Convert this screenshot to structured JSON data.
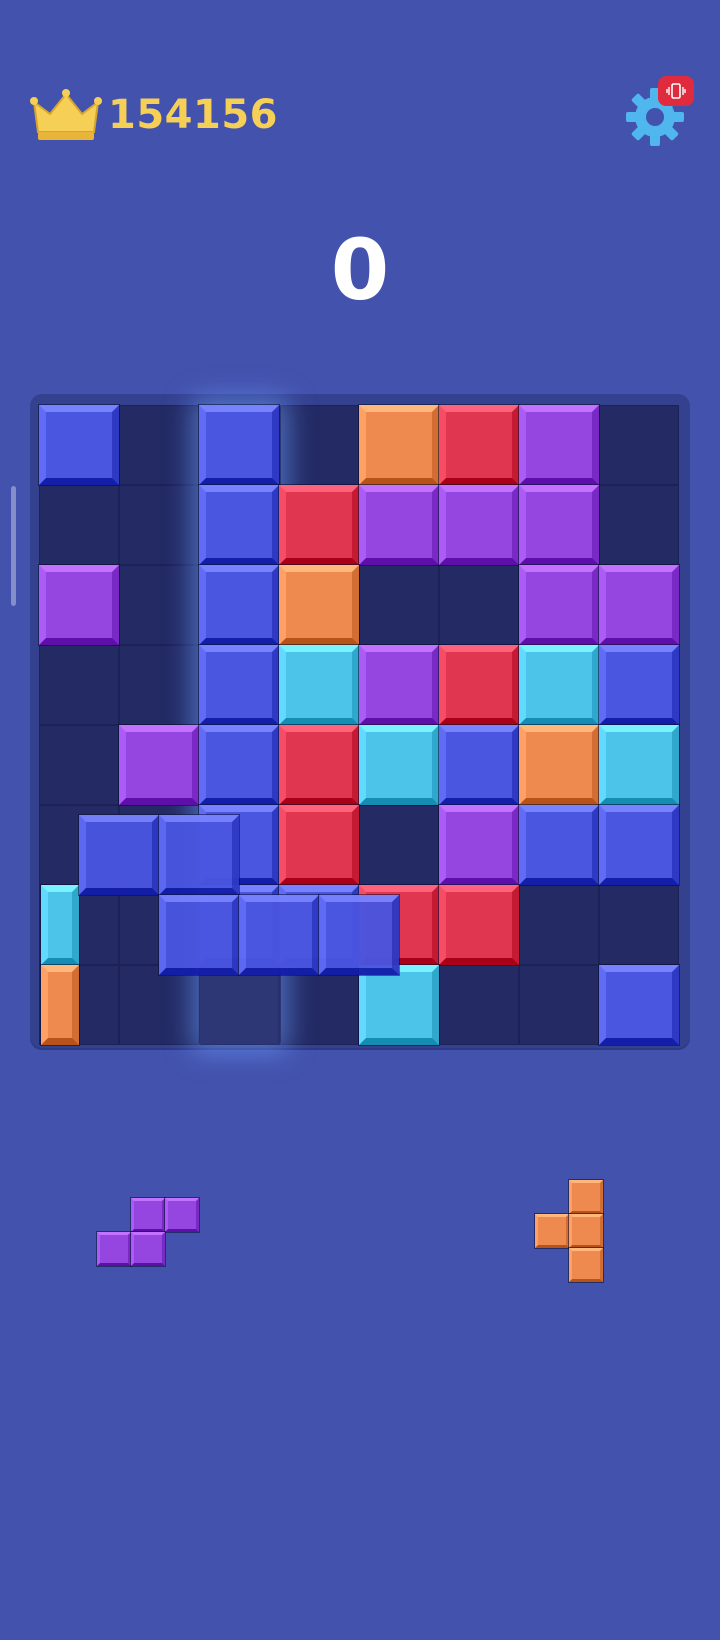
{
  "hud": {
    "best_score": "154156",
    "current_score": "0",
    "crown_icon": "crown-icon",
    "settings_icon": "gear-icon",
    "vibration_icon": "vibration-icon"
  },
  "colors": {
    "background": "#4352ad",
    "board_empty": "#232a64",
    "gold": "#f6cf57",
    "blue": "#4a55e0",
    "purple": "#9545e0",
    "red": "#e0364f",
    "orange": "#ee8a4f",
    "cyan": "#4cc4ea",
    "badge_red": "#e02a3d"
  },
  "board": {
    "rows": 8,
    "cols": 8,
    "highlighted_column": 2,
    "grid": [
      [
        "blue",
        null,
        "blue",
        null,
        "orange",
        "red",
        "purple",
        null
      ],
      [
        null,
        null,
        "blue",
        "red",
        "purple",
        "purple",
        "purple",
        null
      ],
      [
        "purple",
        null,
        "blue",
        "orange",
        null,
        null,
        "purple",
        "purple"
      ],
      [
        null,
        null,
        "blue",
        "cyan",
        "purple",
        "red",
        "cyan",
        "blue"
      ],
      [
        null,
        "purple",
        "blue",
        "red",
        "cyan",
        "blue",
        "orange",
        "cyan"
      ],
      [
        null,
        null,
        "blue",
        "red",
        null,
        "purple",
        "blue",
        "blue"
      ],
      [
        null,
        null,
        "blue",
        "blue",
        "red",
        "red",
        null,
        null
      ],
      [
        null,
        null,
        null,
        null,
        "cyan",
        null,
        null,
        "blue"
      ]
    ]
  },
  "dragging_piece": {
    "color": "blue",
    "cells": [
      [
        0,
        0
      ],
      [
        0,
        1
      ],
      [
        1,
        1
      ],
      [
        1,
        2
      ],
      [
        1,
        3
      ]
    ]
  },
  "edge_blocks": [
    {
      "color": "cyan",
      "row": 6
    },
    {
      "color": "orange",
      "row": 7
    }
  ],
  "tray": [
    {
      "color": "purple",
      "cells": [
        [
          0,
          1
        ],
        [
          0,
          2
        ],
        [
          1,
          0
        ],
        [
          1,
          1
        ]
      ]
    },
    {
      "color": "orange",
      "cells": [
        [
          0,
          1
        ],
        [
          1,
          0
        ],
        [
          1,
          1
        ],
        [
          2,
          1
        ]
      ]
    }
  ]
}
